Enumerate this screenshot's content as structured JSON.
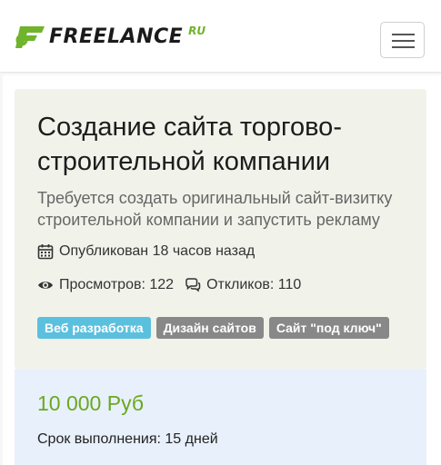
{
  "header": {
    "logo_text": "FREELANCE",
    "logo_suffix": "RU",
    "menu_icon": "hamburger-menu-icon"
  },
  "project": {
    "title": "Создание сайта торгово-строительной компании",
    "description": "Требуется создать оригинальный сайт-визитку строительной компании и запустить рекламу",
    "published": "Опубликован 18 часов назад",
    "views": "Просмотров: 122",
    "responses": "Откликов: 110",
    "tags": [
      "Веб разработка",
      "Дизайн сайтов",
      "Сайт \"под ключ\""
    ],
    "icons": {
      "published": "calendar-icon",
      "views": "eye-icon",
      "responses": "comments-icon"
    }
  },
  "offer": {
    "price": "10 000 Руб",
    "term": "Срок выполнения: 15 дней"
  },
  "colors": {
    "brand_green": "#6fb42c",
    "tag_blue": "#5bc0de",
    "tag_gray": "#888888",
    "card_bg": "#f1f3eb",
    "price_bg": "#e8f0fb"
  }
}
